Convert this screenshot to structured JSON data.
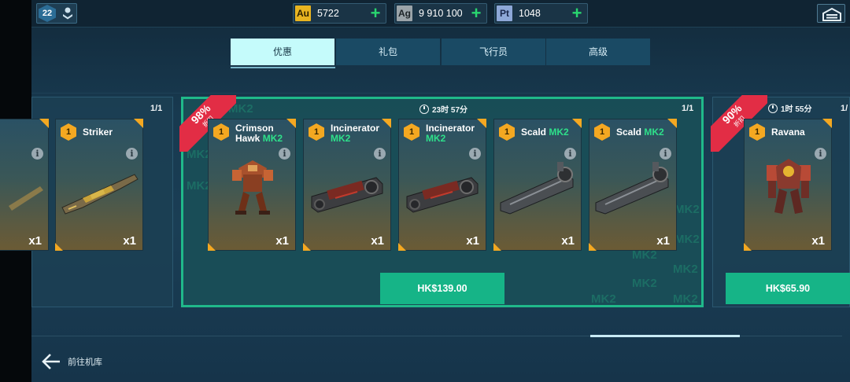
{
  "topbar": {
    "level": "22",
    "resources": [
      {
        "code": "Au",
        "amount": "5722",
        "color": "#e8b420"
      },
      {
        "code": "Ag",
        "amount": "9 910 100",
        "color": "#9ba4a9"
      },
      {
        "code": "Pt",
        "amount": "1048",
        "color": "#8ea8d8"
      }
    ],
    "plus_symbol": "+"
  },
  "tabs": [
    {
      "label": "优惠",
      "active": true
    },
    {
      "label": "礼包",
      "active": false
    },
    {
      "label": "飞行员",
      "active": false
    },
    {
      "label": "高级",
      "active": false
    }
  ],
  "offers": {
    "left": {
      "count": "1/1",
      "cards": [
        {
          "tier": "1",
          "name": "",
          "qty": "x1",
          "icon": "weapon-icon"
        },
        {
          "tier": "1",
          "name": "Striker",
          "mk": "",
          "qty": "x1",
          "icon": "striker-weapon-icon"
        }
      ]
    },
    "main": {
      "discount_pct": "98%",
      "discount_label": "折扣",
      "timer": "23时 57分",
      "count": "1/1",
      "watermark": "MK2",
      "cards": [
        {
          "tier": "1",
          "name": "Crimson Hawk",
          "mk": "MK2",
          "qty": "x1",
          "icon": "crimson-hawk-robot-icon"
        },
        {
          "tier": "1",
          "name": "Incinerator",
          "mk": "MK2",
          "qty": "x1",
          "icon": "incinerator-weapon-icon"
        },
        {
          "tier": "1",
          "name": "Incinerator",
          "mk": "MK2",
          "qty": "x1",
          "icon": "incinerator-weapon-icon"
        },
        {
          "tier": "1",
          "name": "Scald",
          "mk": "MK2",
          "qty": "x1",
          "icon": "scald-weapon-icon"
        },
        {
          "tier": "1",
          "name": "Scald",
          "mk": "MK2",
          "qty": "x1",
          "icon": "scald-weapon-icon"
        }
      ],
      "price": "HK$139.00"
    },
    "right": {
      "discount_pct": "90%",
      "discount_label": "折扣",
      "timer": "1时 55分",
      "count": "1/",
      "cards": [
        {
          "tier": "1",
          "name": "Ravana",
          "mk": "",
          "qty": "x1",
          "icon": "ravana-robot-icon"
        }
      ],
      "price": "HK$65.90"
    }
  },
  "footer": {
    "back_label": "前往机库"
  },
  "info_symbol": "i"
}
